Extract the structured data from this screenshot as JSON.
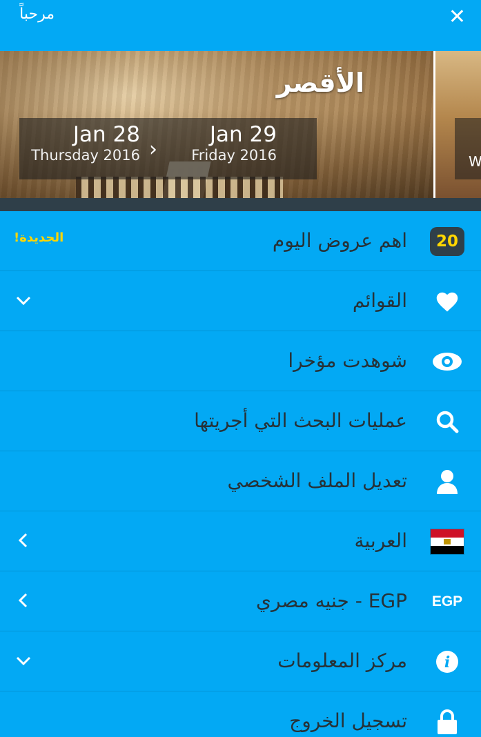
{
  "header": {
    "greeting": "مرحباً",
    "close_icon": "close-icon"
  },
  "hero": {
    "city": "الأقصر",
    "check_in": {
      "date": "Jan 28",
      "weekday_year": "Thursday 2016"
    },
    "check_out": {
      "date": "Jan 29",
      "weekday_year": "Friday 2016"
    },
    "next_card_text": "W"
  },
  "menu": {
    "items": [
      {
        "label": "اهم عروض اليوم",
        "badge": "20",
        "tag": "الجديدة!"
      },
      {
        "label": "القوائم",
        "icon": "heart-icon"
      },
      {
        "label": "شوهدت مؤخرا",
        "icon": "eye-icon"
      },
      {
        "label": "عمليات البحث التي أجريتها",
        "icon": "search-icon"
      },
      {
        "label": "تعديل الملف الشخصي",
        "icon": "user-icon"
      },
      {
        "label": "العربية",
        "icon": "egypt-flag-icon"
      },
      {
        "label": "EGP - جنيه مصري",
        "code": "EGP"
      },
      {
        "label": "مركز المعلومات",
        "icon": "info-icon"
      },
      {
        "label": "تسجيل الخروج",
        "icon": "lock-icon"
      }
    ]
  },
  "colors": {
    "background": "#03a9f4",
    "dark": "#2f3f49",
    "accent_yellow": "#ffd600",
    "text": "#263238"
  }
}
